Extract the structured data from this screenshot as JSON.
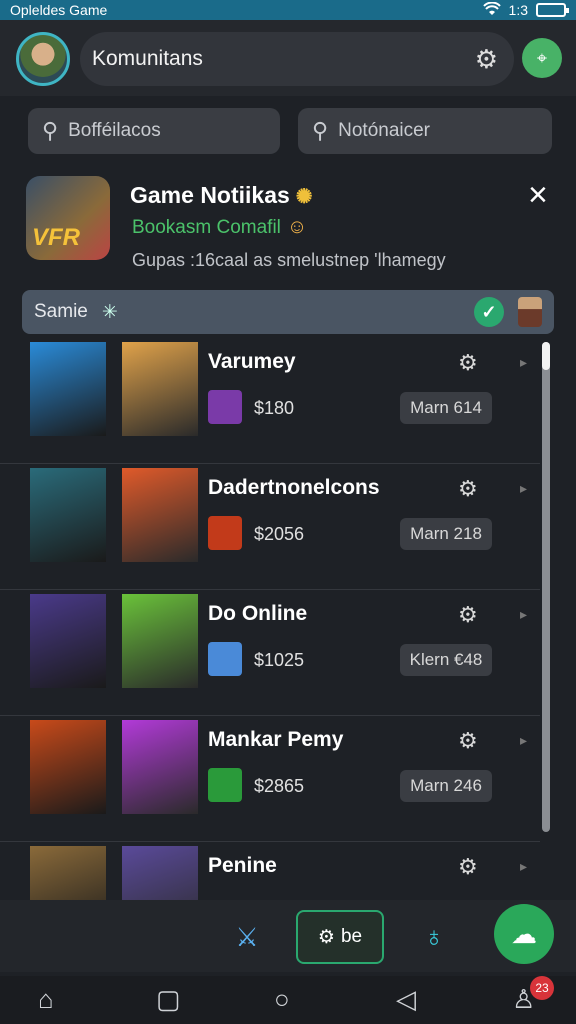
{
  "status_bar": {
    "title": "Opleldes Game",
    "time": "1:3"
  },
  "header": {
    "community_label": "Komunitans"
  },
  "search": {
    "left_placeholder": "Bofféilacos",
    "right_placeholder": "Notónaicer"
  },
  "notification": {
    "title": "Game Notiikas",
    "subtitle": "Bookasm Comafil",
    "body": "Gupas :16caal as smelustnep 'lhamegy",
    "logo_text": "VFR"
  },
  "filter": {
    "label": "Samie"
  },
  "items": [
    {
      "name": "Varumey",
      "price": "$180",
      "tag": "Marn 614",
      "thumb_a": "#2a8bd8",
      "thumb_b": "#e0a24a",
      "icon_color": "#7a3aa8"
    },
    {
      "name": "Dadertnonelcons",
      "price": "$2056",
      "tag": "Marn 218",
      "thumb_a": "#2a6b7a",
      "thumb_b": "#e05a2a",
      "icon_color": "#c23a1a"
    },
    {
      "name": "Do Online",
      "price": "$1025",
      "tag": "Klern €48",
      "thumb_a": "#4a3a8a",
      "thumb_b": "#6ac23a",
      "icon_color": "#4a8ad8"
    },
    {
      "name": "Mankar Pemy",
      "price": "$2865",
      "tag": "Marn 246",
      "thumb_a": "#c84a1a",
      "thumb_b": "#b23ad8",
      "icon_color": "#2a9a3a"
    },
    {
      "name": "Penine",
      "price": "",
      "tag": "",
      "thumb_a": "#8a6a3a",
      "thumb_b": "#5a4a9a",
      "icon_color": "#444"
    }
  ],
  "action_bar": {
    "be_label": "be"
  },
  "nav": {
    "badge": "23"
  },
  "colors": {
    "accent": "#2aa86f",
    "status_bar": "#1a6b8a",
    "background": "#1e2126"
  }
}
